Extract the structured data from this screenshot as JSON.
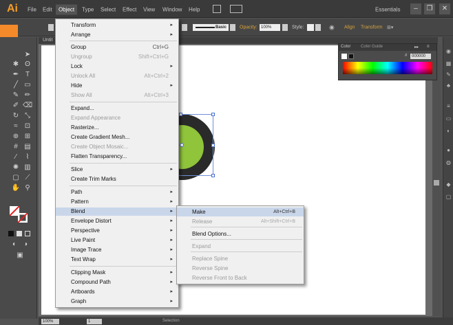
{
  "app": {
    "logo": "Ai",
    "menus": [
      "File",
      "Edit",
      "Object",
      "Type",
      "Select",
      "Effect",
      "View",
      "Window",
      "Help"
    ],
    "workspace": "Essentials",
    "window_buttons": [
      "–",
      "❐",
      "✕"
    ]
  },
  "control_bar": {
    "stroke_style": "Basic",
    "opacity_label": "Opacity:",
    "opacity_value": "100%",
    "style_label": "Style:",
    "align_label": "Align",
    "transform_label": "Transform"
  },
  "document": {
    "tab_label": "Untit"
  },
  "color_panel": {
    "tabs": [
      "Color",
      "Color Guide"
    ],
    "hex_label": "#",
    "hex_value": "000000"
  },
  "object_menu": {
    "items": [
      {
        "label": "Transform",
        "shortcut": "",
        "submenu": true,
        "disabled": false
      },
      {
        "label": "Arrange",
        "shortcut": "",
        "submenu": true,
        "disabled": false
      },
      {
        "label": "Group",
        "shortcut": "Ctrl+G",
        "submenu": false,
        "disabled": false
      },
      {
        "label": "Ungroup",
        "shortcut": "Shift+Ctrl+G",
        "submenu": false,
        "disabled": true
      },
      {
        "label": "Lock",
        "shortcut": "",
        "submenu": true,
        "disabled": false
      },
      {
        "label": "Unlock All",
        "shortcut": "Alt+Ctrl+2",
        "submenu": false,
        "disabled": true
      },
      {
        "label": "Hide",
        "shortcut": "",
        "submenu": true,
        "disabled": false
      },
      {
        "label": "Show All",
        "shortcut": "Alt+Ctrl+3",
        "submenu": false,
        "disabled": true
      },
      {
        "label": "Expand...",
        "shortcut": "",
        "submenu": false,
        "disabled": false
      },
      {
        "label": "Expand Appearance",
        "shortcut": "",
        "submenu": false,
        "disabled": true
      },
      {
        "label": "Rasterize...",
        "shortcut": "",
        "submenu": false,
        "disabled": false
      },
      {
        "label": "Create Gradient Mesh...",
        "shortcut": "",
        "submenu": false,
        "disabled": false
      },
      {
        "label": "Create Object Mosaic...",
        "shortcut": "",
        "submenu": false,
        "disabled": true
      },
      {
        "label": "Flatten Transparency...",
        "shortcut": "",
        "submenu": false,
        "disabled": false
      },
      {
        "label": "Slice",
        "shortcut": "",
        "submenu": true,
        "disabled": false
      },
      {
        "label": "Create Trim Marks",
        "shortcut": "",
        "submenu": false,
        "disabled": false
      },
      {
        "label": "Path",
        "shortcut": "",
        "submenu": true,
        "disabled": false
      },
      {
        "label": "Pattern",
        "shortcut": "",
        "submenu": true,
        "disabled": false
      },
      {
        "label": "Blend",
        "shortcut": "",
        "submenu": true,
        "disabled": false
      },
      {
        "label": "Envelope Distort",
        "shortcut": "",
        "submenu": true,
        "disabled": false
      },
      {
        "label": "Perspective",
        "shortcut": "",
        "submenu": true,
        "disabled": false
      },
      {
        "label": "Live Paint",
        "shortcut": "",
        "submenu": true,
        "disabled": false
      },
      {
        "label": "Image Trace",
        "shortcut": "",
        "submenu": true,
        "disabled": false
      },
      {
        "label": "Text Wrap",
        "shortcut": "",
        "submenu": true,
        "disabled": false
      },
      {
        "label": "Clipping Mask",
        "shortcut": "",
        "submenu": true,
        "disabled": false
      },
      {
        "label": "Compound Path",
        "shortcut": "",
        "submenu": true,
        "disabled": false
      },
      {
        "label": "Artboards",
        "shortcut": "",
        "submenu": true,
        "disabled": false
      },
      {
        "label": "Graph",
        "shortcut": "",
        "submenu": true,
        "disabled": false
      }
    ]
  },
  "blend_menu": {
    "items": [
      {
        "label": "Make",
        "shortcut": "Alt+Ctrl+B",
        "disabled": false
      },
      {
        "label": "Release",
        "shortcut": "Alt+Shift+Ctrl+B",
        "disabled": true
      },
      {
        "label": "Blend Options...",
        "shortcut": "",
        "disabled": false
      },
      {
        "label": "Expand",
        "shortcut": "",
        "disabled": true
      },
      {
        "label": "Replace Spine",
        "shortcut": "",
        "disabled": true
      },
      {
        "label": "Reverse Spine",
        "shortcut": "",
        "disabled": true
      },
      {
        "label": "Reverse Front to Back",
        "shortcut": "",
        "disabled": true
      }
    ]
  },
  "status_bar": {
    "zoom": "100%",
    "artboard_number": "1",
    "mode": "Selection"
  },
  "colors": {
    "orange_accent": "#f58a2a",
    "inner_circle": "#8fc43b",
    "outer_ring": "#2a2a2a",
    "menu_highlight": "#c9d6ea"
  }
}
